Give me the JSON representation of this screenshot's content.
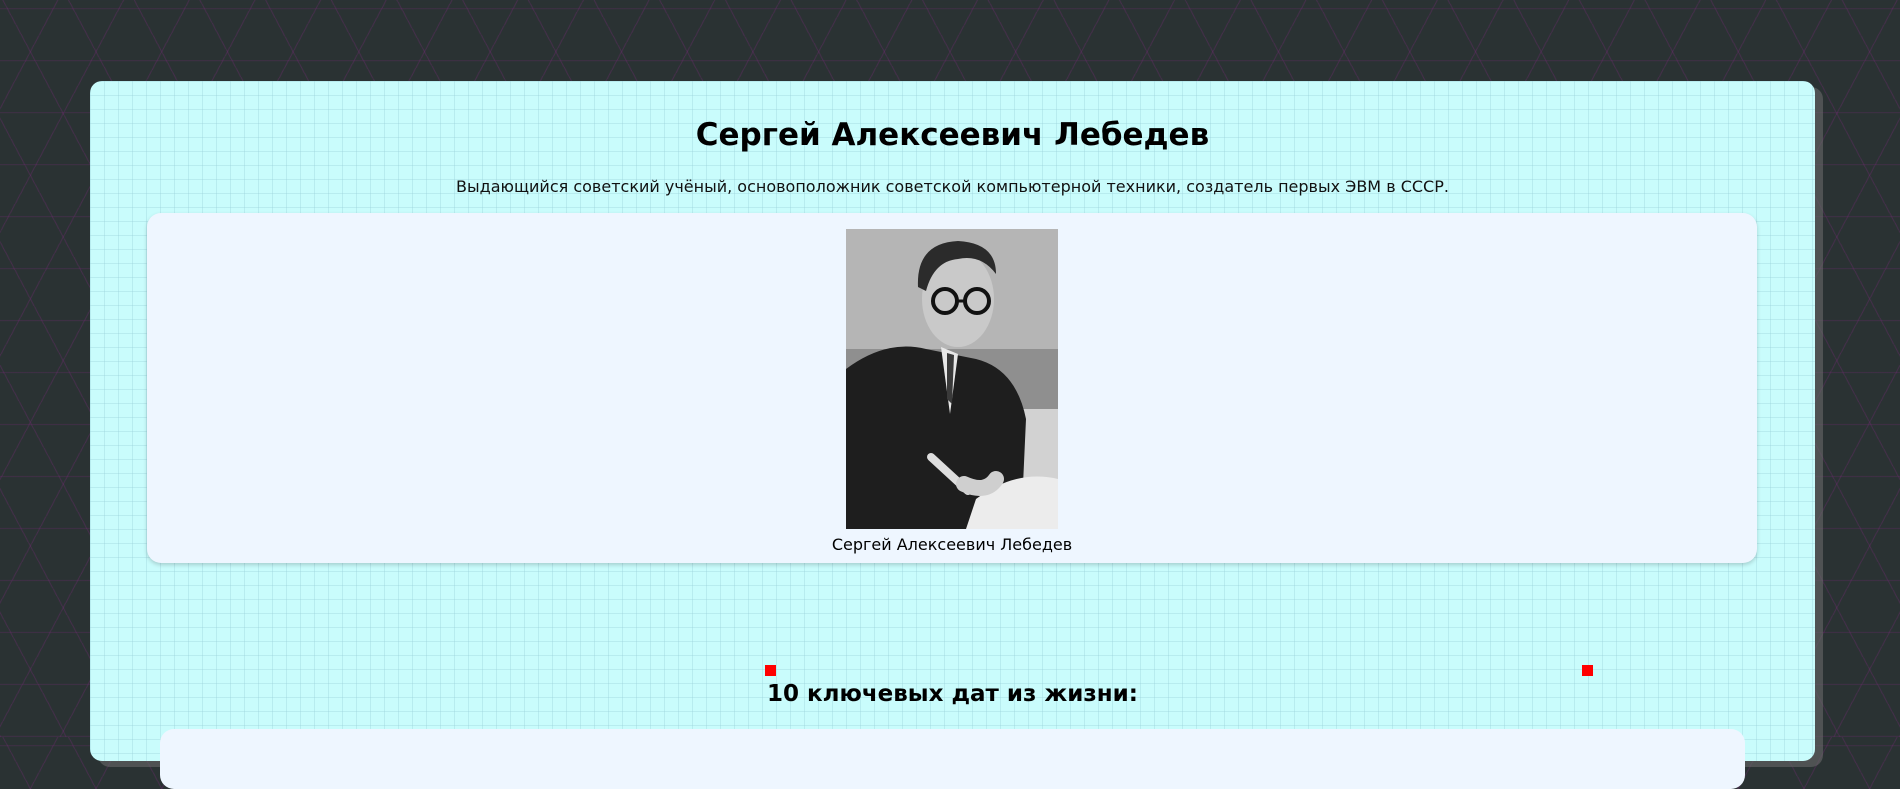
{
  "page": {
    "title": "Сергей Алексеевич Лебедев",
    "subtitle": "Выдающийся советский учёный, основоположник советской компьютерной техники, создатель первых ЭВМ в СССР.",
    "photo": {
      "alt": "Сергей Алексеевич Лебедев",
      "caption": "Сергей Алексеевич Лебедев"
    },
    "timeline_heading": "10 ключевых дат из жизни:"
  },
  "colors": {
    "background": "#2a3233",
    "card": "#c9fcfc",
    "panel": "#eef6ff",
    "marker": "#ff0000"
  }
}
